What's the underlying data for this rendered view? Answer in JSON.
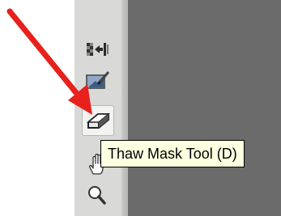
{
  "tooltip": {
    "text": "Thaw Mask Tool (D)"
  },
  "toolbar": {
    "tools": [
      {
        "name": "reconstruct-tool",
        "icon": "reconstruct-icon"
      },
      {
        "name": "freeze-mask-tool",
        "icon": "freeze-mask-icon"
      },
      {
        "name": "thaw-mask-tool",
        "icon": "thaw-mask-icon",
        "state": "hovered"
      },
      {
        "name": "hand-tool",
        "icon": "hand-icon"
      },
      {
        "name": "zoom-tool",
        "icon": "zoom-icon"
      }
    ]
  },
  "annotation": {
    "arrow_color": "#e8211c",
    "points_to": "thaw-mask-tool"
  },
  "colors": {
    "canvas": "#6b6b6b",
    "toolbar": "#d9d9d7",
    "tooltip_bg": "#ffffe1"
  }
}
